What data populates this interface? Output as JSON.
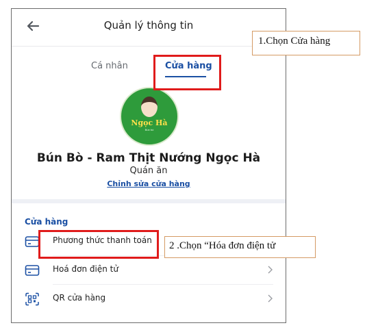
{
  "header": {
    "title": "Quản lý thông tin"
  },
  "tabs": [
    {
      "label": "Cá nhân"
    },
    {
      "label": "Cửa hàng"
    }
  ],
  "store": {
    "logo_text": "Ngọc Hà",
    "logo_small_text": "Bún bò",
    "name": "Bún Bò - Ram Thịt Nướng Ngọc Hà",
    "type": "Quán ăn",
    "edit_label": "Chỉnh sửa cửa hàng"
  },
  "section": {
    "title": "Cửa hàng",
    "items": [
      {
        "label": "Phương thức thanh toán",
        "icon": "card-icon"
      },
      {
        "label": "Hoá đơn điện tử",
        "icon": "invoice-card-icon"
      },
      {
        "label": "QR cửa hàng",
        "icon": "qr-scan-icon"
      }
    ]
  },
  "annotations": {
    "step1": "1.Chọn Cửa hàng",
    "step2": "2 .Chọn “Hóa đơn điện tử"
  },
  "colors": {
    "accent": "#1a4fa3",
    "highlight": "#e01b1b",
    "callout_border": "#d49a63"
  }
}
